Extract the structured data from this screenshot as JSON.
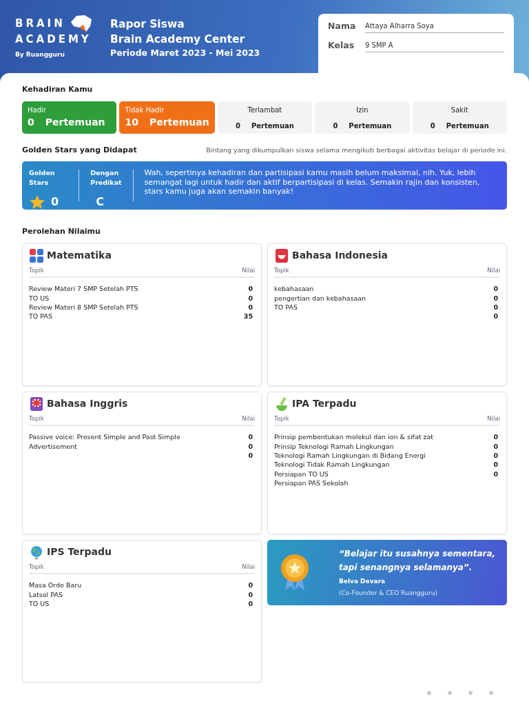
{
  "logo": {
    "line_1": "BRAIN",
    "line_2": "ACADEMY",
    "byline": "By Ruangguru"
  },
  "report": {
    "title": "Rapor Siswa",
    "center": "Brain Academy Center",
    "period": "Periode Maret 2023 - Mei 2023"
  },
  "student": [
    {
      "label": "Nama",
      "value": "Attaya Alharra Soya"
    },
    {
      "label": "Kelas",
      "value": "9 SMP A"
    }
  ],
  "attendance": {
    "title": "Kehadiran Kamu",
    "items": [
      {
        "kind": "colored",
        "label": "Hadir",
        "count": "0",
        "unit": "Pertemuan",
        "color": "#2e9e3a"
      },
      {
        "kind": "colored",
        "label": "Tidak Hadir",
        "count": "10",
        "unit": "Pertemuan",
        "color": "#f07018"
      },
      {
        "kind": "plain",
        "label": "Terlambat",
        "count": "0",
        "unit": "Pertemuan"
      },
      {
        "kind": "plain",
        "label": "Izin",
        "count": "0",
        "unit": "Pertemuan"
      },
      {
        "kind": "plain",
        "label": "Sakit",
        "count": "0",
        "unit": "Pertemuan"
      }
    ]
  },
  "golden_stars": {
    "title": "Golden Stars yang Didapat",
    "note": "Bintang yang dikumpulkan siswa selama mengikuti berbagai aktivitas belajar di periode ini.",
    "stars_label": "Golden Stars",
    "stars_value": "0",
    "grade_label": "Dengan Predikat",
    "grade": "C",
    "message": "Wah, sepertinya kehadiran dan partisipasi kamu masih belum maksimal, nih. Yuk, lebih semangat lagi untuk hadir dan aktif berpartisipasi di kelas. Semakin rajin dan konsisten, stars kamu juga akan semakin banyak!"
  },
  "scores": {
    "title": "Perolehan Nilaimu",
    "subjects": [
      {
        "kind": "math",
        "name": "Matematika",
        "topic_header": "Topik",
        "score_header": "Nilai",
        "rows": [
          {
            "topic": "Review Materi 7 SMP Setelah PTS",
            "score": "0"
          },
          {
            "topic": "TO US",
            "score": "0"
          },
          {
            "topic": "Review Materi 8 SMP Setelah PTS",
            "score": "0"
          },
          {
            "topic": "TO PAS",
            "score": "35"
          }
        ]
      },
      {
        "kind": "indonesian",
        "name": "Bahasa Indonesia",
        "topic_header": "Topik",
        "score_header": "Nilai",
        "rows": [
          {
            "topic": "kebahasaan",
            "score": "0"
          },
          {
            "topic": "pengertian dan kebahasaan",
            "score": "0"
          },
          {
            "topic": "TO PAS",
            "score": "0"
          },
          {
            "score": "0"
          }
        ]
      },
      {
        "kind": "english",
        "name": "Bahasa Inggris",
        "topic_header": "Topik",
        "score_header": "Nilai",
        "rows": [
          {
            "topic": "Passive voice: Present Simple and Past Simple",
            "score": "0"
          },
          {
            "topic": "Advertisement",
            "score": "0"
          },
          {
            "score": "0"
          }
        ]
      },
      {
        "kind": "science",
        "name": "IPA Terpadu",
        "topic_header": "Topik",
        "score_header": "Nilai",
        "rows": [
          {
            "topic": "Prinsip pembentukan molekul dan ion & sifat zat",
            "score": "0"
          },
          {
            "topic": "Prinsip Teknologi Ramah Lingkungan",
            "score": "0"
          },
          {
            "topic": "Teknologi Ramah Lingkungan di Bidang Energi",
            "score": "0"
          },
          {
            "topic": "Teknologi Tidak Ramah Lingkungan",
            "score": "0"
          },
          {
            "topic": "Persiapan TO US",
            "score": "0"
          },
          {
            "topic": "Persiapan PAS Sekolah"
          }
        ]
      },
      {
        "kind": "social",
        "name": "IPS Terpadu",
        "topic_header": "Topik",
        "score_header": "Nilai",
        "rows": [
          {
            "topic": "Masa Orde Baru",
            "score": "0"
          },
          {
            "topic": "Latsol PAS",
            "score": "0"
          },
          {
            "topic": "TO US",
            "score": "0"
          }
        ]
      }
    ],
    "quote": {
      "text": "“Belajar itu susahnya sementara, tapi senangnya selamanya”.",
      "author": "Belva Devara",
      "role": "(Co-Founder & CEO Ruangguru)"
    }
  }
}
